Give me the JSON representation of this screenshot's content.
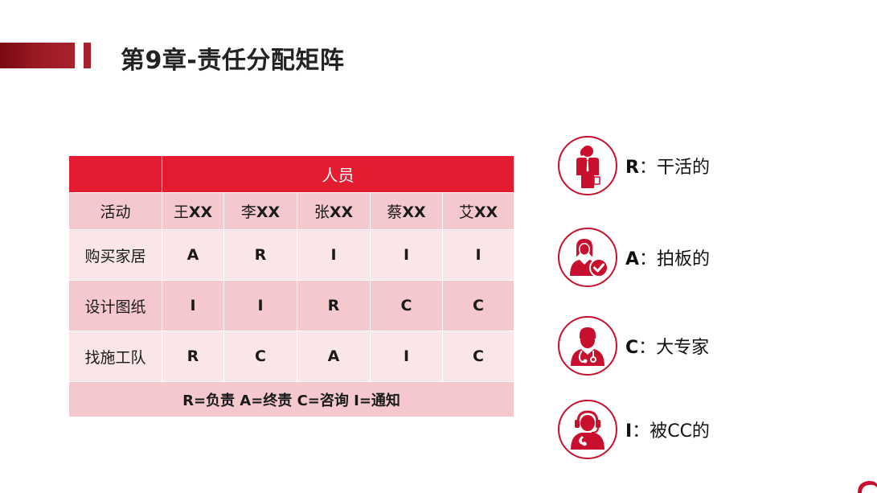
{
  "title": "第9章-责任分配矩阵",
  "table": {
    "group_header": "人员",
    "activity_header": "活动",
    "people": [
      "王",
      "李",
      "张",
      "蔡",
      "艾"
    ],
    "people_suffix": "XX",
    "rows": [
      {
        "activity": "购买家居",
        "cells": [
          "A",
          "R",
          "I",
          "I",
          "I"
        ]
      },
      {
        "activity": "设计图纸",
        "cells": [
          "I",
          "I",
          "R",
          "C",
          "C"
        ]
      },
      {
        "activity": "找施工队",
        "cells": [
          "R",
          "C",
          "A",
          "I",
          "C"
        ]
      }
    ],
    "legend": "R=负责 A=终责 C=咨询 I=通知"
  },
  "roles": [
    {
      "letter": "R",
      "sep": "：",
      "desc": "干活的",
      "icon": "worker-on-phone-icon"
    },
    {
      "letter": "A",
      "sep": "：",
      "desc": "拍板的",
      "icon": "approver-checkmark-icon"
    },
    {
      "letter": "C",
      "sep": "：",
      "desc": "大专家",
      "icon": "doctor-expert-icon"
    },
    {
      "letter": "I",
      "sep": "：",
      "desc": "被CC的",
      "icon": "headset-operator-icon"
    }
  ],
  "colors": {
    "accent": "#e31d2f",
    "dark_accent": "#8b1520",
    "row_light": "#fae6e8",
    "row_mid": "#f4c8cd"
  }
}
